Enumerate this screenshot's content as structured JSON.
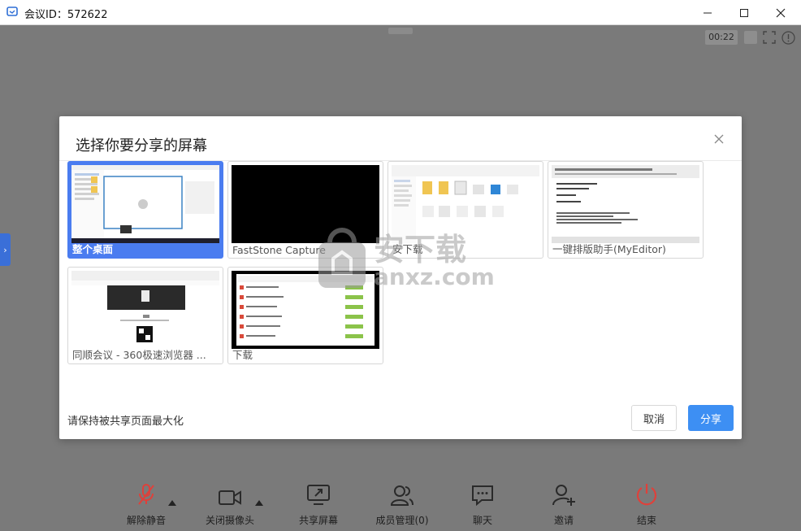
{
  "window": {
    "title": "会议ID：572622"
  },
  "stage": {
    "timer": "00:22"
  },
  "dialog": {
    "title": "选择你要分享的屏幕",
    "screens": [
      {
        "label": "整个桌面",
        "selected": true
      },
      {
        "label": "FastStone Capture",
        "selected": false
      },
      {
        "label": "安下载",
        "selected": false
      },
      {
        "label": "一键排版助手(MyEditor)",
        "selected": false
      },
      {
        "label": "同顺会议 - 360极速浏览器 ...",
        "selected": false
      },
      {
        "label": "下载",
        "selected": false
      }
    ],
    "hint": "请保持被共享页面最大化",
    "cancel_label": "取消",
    "share_label": "分享"
  },
  "toolbar": {
    "items": [
      {
        "label": "解除静音",
        "icon": "mic-muted-icon",
        "color": "#e0403a"
      },
      {
        "label": "关闭摄像头",
        "icon": "camera-icon"
      },
      {
        "label": "共享屏幕",
        "icon": "share-screen-icon"
      },
      {
        "label": "成员管理(0)",
        "icon": "members-icon"
      },
      {
        "label": "聊天",
        "icon": "chat-icon"
      },
      {
        "label": "邀请",
        "icon": "invite-icon"
      },
      {
        "label": "结束",
        "icon": "power-icon",
        "color": "#e0403a"
      }
    ]
  },
  "watermark": {
    "text": "安下载",
    "subtext": "anxz.com"
  }
}
